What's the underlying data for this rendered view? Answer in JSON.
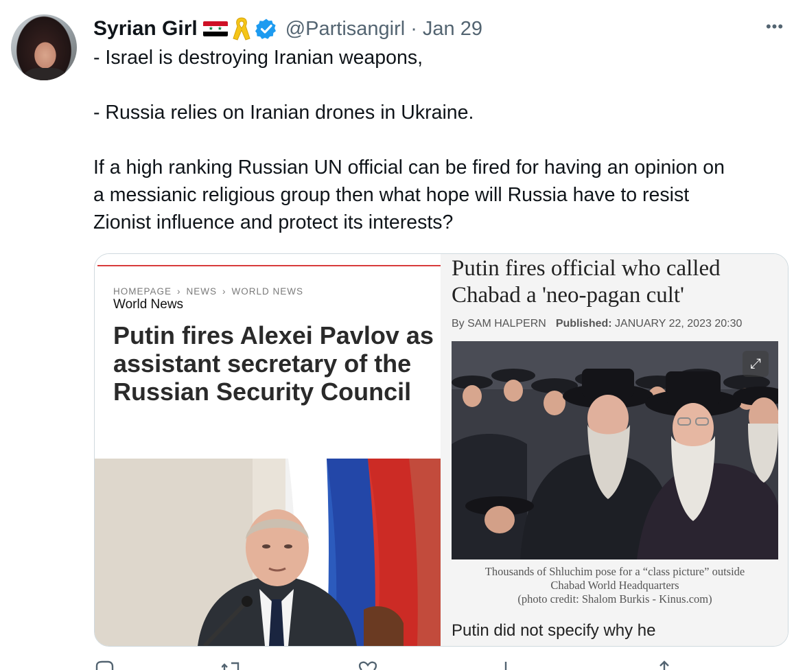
{
  "author": {
    "name": "Syrian Girl",
    "handle": "@Partisangirl",
    "separator": "·",
    "date": "Jan 29",
    "flag_icon": "syria-flag-icon",
    "ribbon_icon": "yellow-ribbon-icon",
    "verified_icon": "verified-badge-icon",
    "colors": {
      "verified": "#1d9bf0",
      "handle": "#536471"
    }
  },
  "more_label": "•••",
  "tweet": {
    "lines": [
      "- Israel is destroying Iranian weapons,",
      "",
      "- Russia relies on Iranian drones in Ukraine.",
      "",
      "If a high ranking Russian UN official can be fired for having an opinion on",
      "a messianic religious group then what hope will Russia have to resist",
      "Zionist influence and protect its interests?"
    ]
  },
  "left_article": {
    "breadcrumbs": [
      "HOMEPAGE",
      "NEWS",
      "WORLD NEWS"
    ],
    "breadcrumb_sep": "›",
    "section": "World News",
    "headline": "Putin fires Alexei Pavlov as assistant secretary of the Russian Security Council",
    "accent_color": "#d83a3a"
  },
  "right_article": {
    "headline": "Putin fires official who called Chabad a 'neo-pagan cult'",
    "byline_author": "By SAM HALPERN",
    "byline_label": "Published:",
    "byline_date": "JANUARY 22, 2023 20:30",
    "caption_lines": [
      "Thousands of Shluchim pose for a “class picture” outside",
      "Chabad World Headquarters",
      "(photo credit: Shalom Burkis - Kinus.com)"
    ],
    "expand_icon": "expand-icon",
    "snippet": "Putin did not specify why he"
  },
  "actions": [
    "reply-icon",
    "retweet-icon",
    "like-icon",
    "views-icon",
    "share-icon"
  ]
}
